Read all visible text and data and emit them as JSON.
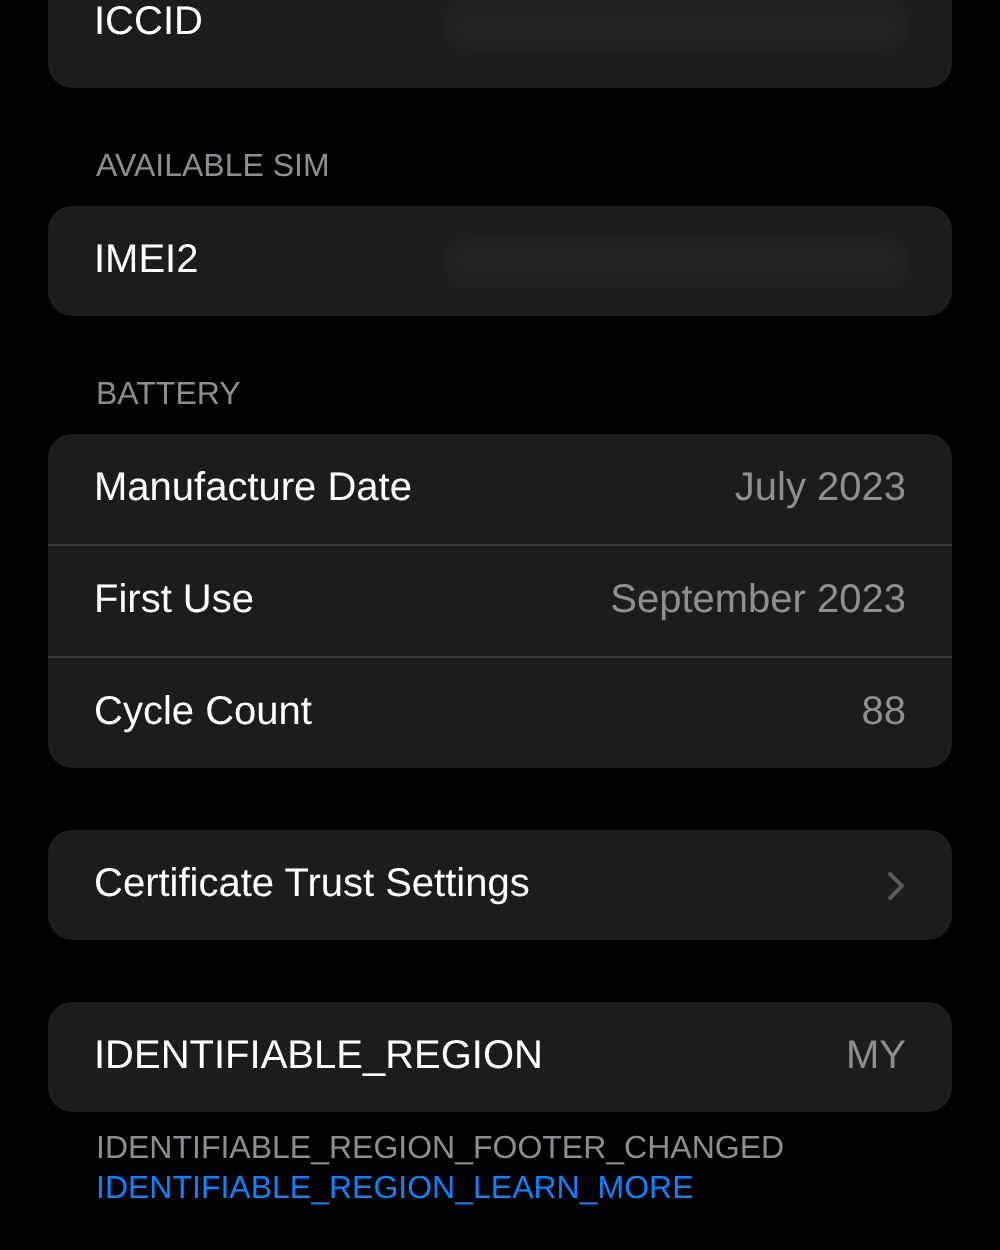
{
  "groups": [
    {
      "rows": [
        {
          "kind": "redacted",
          "label": "ICCID"
        }
      ]
    },
    {
      "header": "AVAILABLE SIM",
      "rows": [
        {
          "kind": "redacted",
          "label": "IMEI2"
        }
      ]
    },
    {
      "header": "BATTERY",
      "rows": [
        {
          "kind": "value",
          "label": "Manufacture Date",
          "value": "July 2023"
        },
        {
          "kind": "value",
          "label": "First Use",
          "value": "September 2023"
        },
        {
          "kind": "value",
          "label": "Cycle Count",
          "value": "88"
        }
      ]
    },
    {
      "rows": [
        {
          "kind": "link",
          "label": "Certificate Trust Settings"
        }
      ]
    },
    {
      "rows": [
        {
          "kind": "value",
          "label": "IDENTIFIABLE_REGION",
          "value": "MY"
        }
      ],
      "footer": "IDENTIFIABLE_REGION_FOOTER_CHANGED",
      "footer_link": "IDENTIFIABLE_REGION_LEARN_MORE"
    }
  ]
}
